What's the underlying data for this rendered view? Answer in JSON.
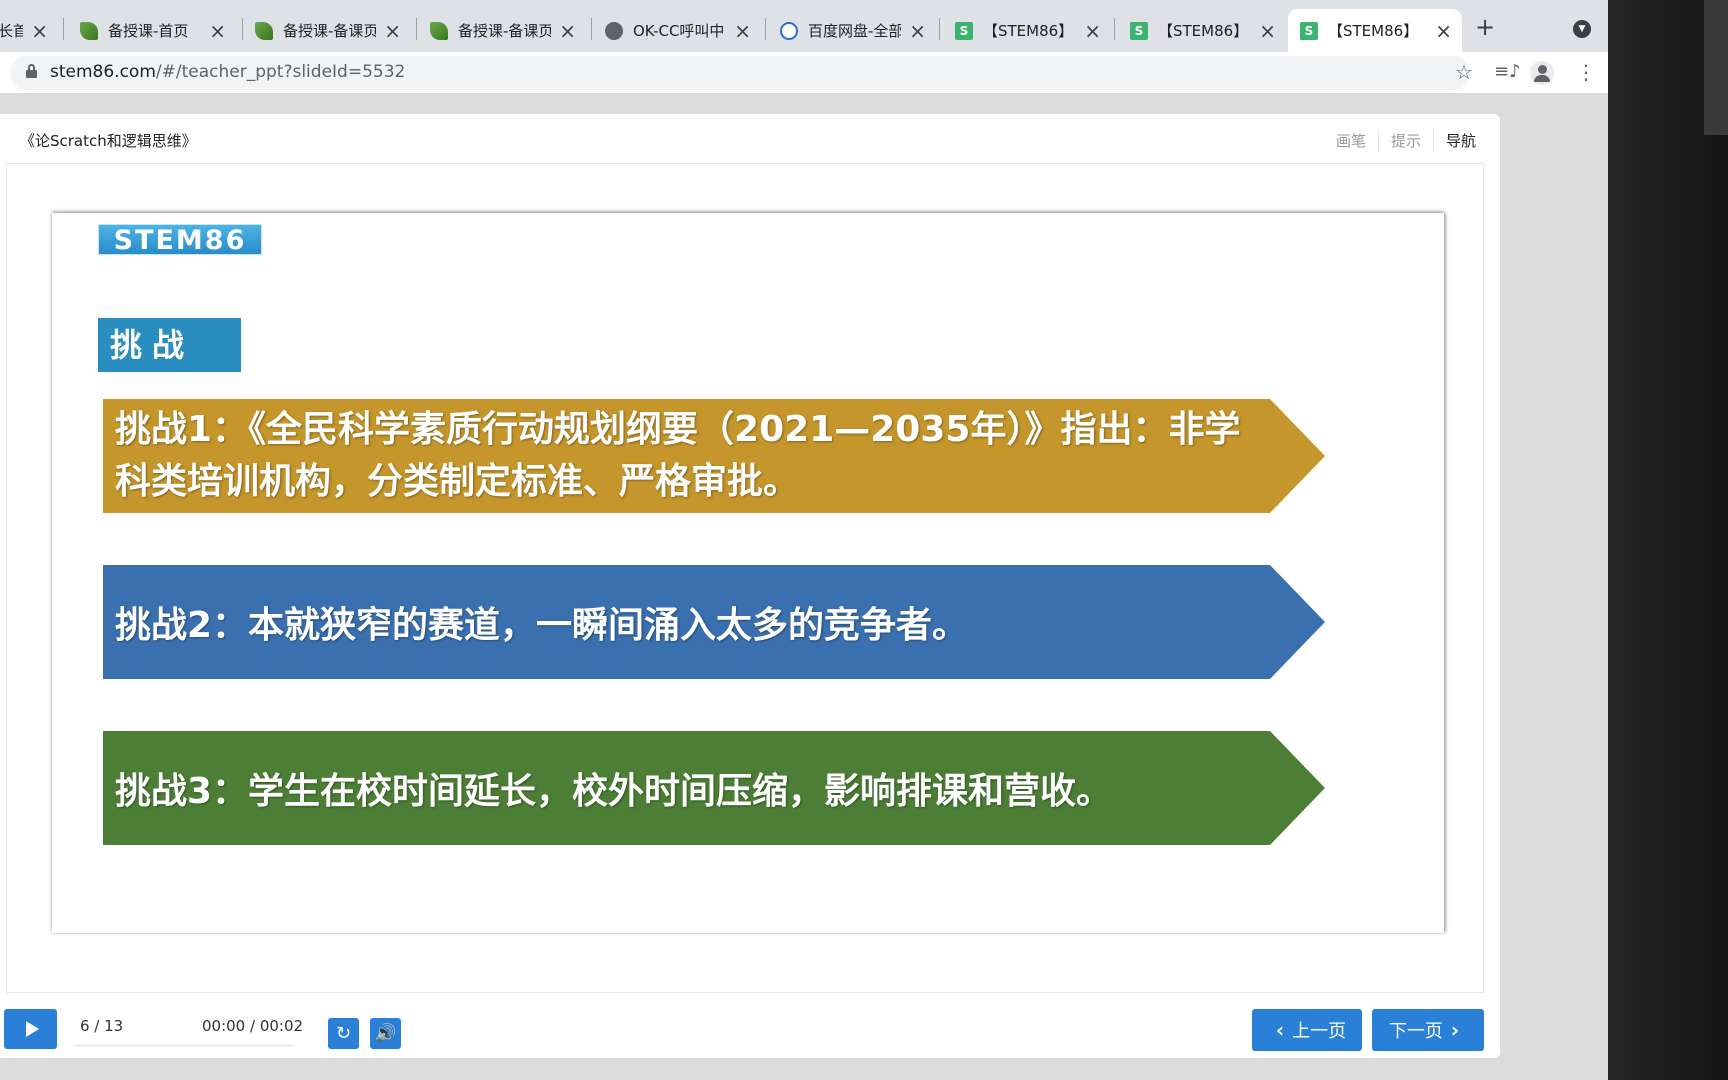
{
  "browser": {
    "tabs": [
      {
        "title": "长首",
        "icon": "partial-tab"
      },
      {
        "title": "备授课-首页",
        "icon": "leaf-icon"
      },
      {
        "title": "备授课-备课页",
        "icon": "leaf-icon"
      },
      {
        "title": "备授课-备课页",
        "icon": "leaf-icon"
      },
      {
        "title": "OK-CC呼叫中",
        "icon": "globe-icon"
      },
      {
        "title": "百度网盘-全部",
        "icon": "baidu-icon"
      },
      {
        "title": "【STEM86】",
        "icon": "stem-icon"
      },
      {
        "title": "【STEM86】",
        "icon": "stem-icon"
      },
      {
        "title": "【STEM86】",
        "icon": "stem-icon"
      }
    ],
    "url_host": "stem86.com",
    "url_path": "/#/teacher_ppt?slideId=5532"
  },
  "header": {
    "doc_title": "《论Scratch和逻辑思维》",
    "nav": [
      "画笔",
      "提示",
      "导航"
    ]
  },
  "slide": {
    "logo": "STEM86",
    "heading": "挑战",
    "challenges": [
      {
        "text": "挑战1：《全民科学素质行动规划纲要（2021—2035年）》指出：非学科类培训机构，分类制定标准、严格审批。",
        "color": "#c4962b"
      },
      {
        "text": "挑战2：本就狭窄的赛道，一瞬间涌入太多的竞争者。",
        "color": "#3a70af"
      },
      {
        "text": "挑战3：学生在校时间延长，校外时间压缩，影响排课和营收。",
        "color": "#4c7f35"
      }
    ]
  },
  "controls": {
    "page": "6 / 13",
    "time": "00:00 / 00:02",
    "progress": 0,
    "prev": "上一页",
    "next": "下一页"
  }
}
